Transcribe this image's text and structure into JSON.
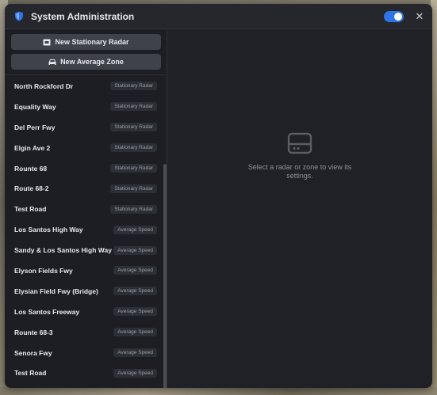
{
  "window": {
    "title": "System Administration",
    "toggle_on": true,
    "accent_color": "#2f74e6"
  },
  "actions": [
    {
      "label": "New Stationary Radar",
      "icon": "radar-icon"
    },
    {
      "label": "New Average Zone",
      "icon": "car-icon"
    }
  ],
  "list": [
    {
      "label": "North Rockford Dr",
      "badge": "Stationary Radar"
    },
    {
      "label": "Equality Way",
      "badge": "Stationary Radar"
    },
    {
      "label": "Del Perr Fwy",
      "badge": "Stationary Radar"
    },
    {
      "label": "Elgin Ave 2",
      "badge": "Stationary Radar"
    },
    {
      "label": "Rounte 68",
      "badge": "Stationary Radar"
    },
    {
      "label": "Route 68-2",
      "badge": "Stationary Radar"
    },
    {
      "label": "Test Road",
      "badge": "Stationary Radar"
    },
    {
      "label": "Los Santos High Way",
      "badge": "Average Speed"
    },
    {
      "label": "Sandy & Los Santos High Way",
      "badge": "Average Speed"
    },
    {
      "label": "Elyson Fields Fwy",
      "badge": "Average Speed"
    },
    {
      "label": "Elysian Field Fwy (Bridge)",
      "badge": "Average Speed"
    },
    {
      "label": "Los Santos Freeway",
      "badge": "Average Speed"
    },
    {
      "label": "Rounte 68-3",
      "badge": "Average Speed"
    },
    {
      "label": "Senora Fwy",
      "badge": "Average Speed"
    },
    {
      "label": "Test Road",
      "badge": "Average Speed"
    }
  ],
  "main": {
    "placeholder_icon": "hard-drive-icon",
    "placeholder_text": "Select a radar or zone to view its settings."
  }
}
